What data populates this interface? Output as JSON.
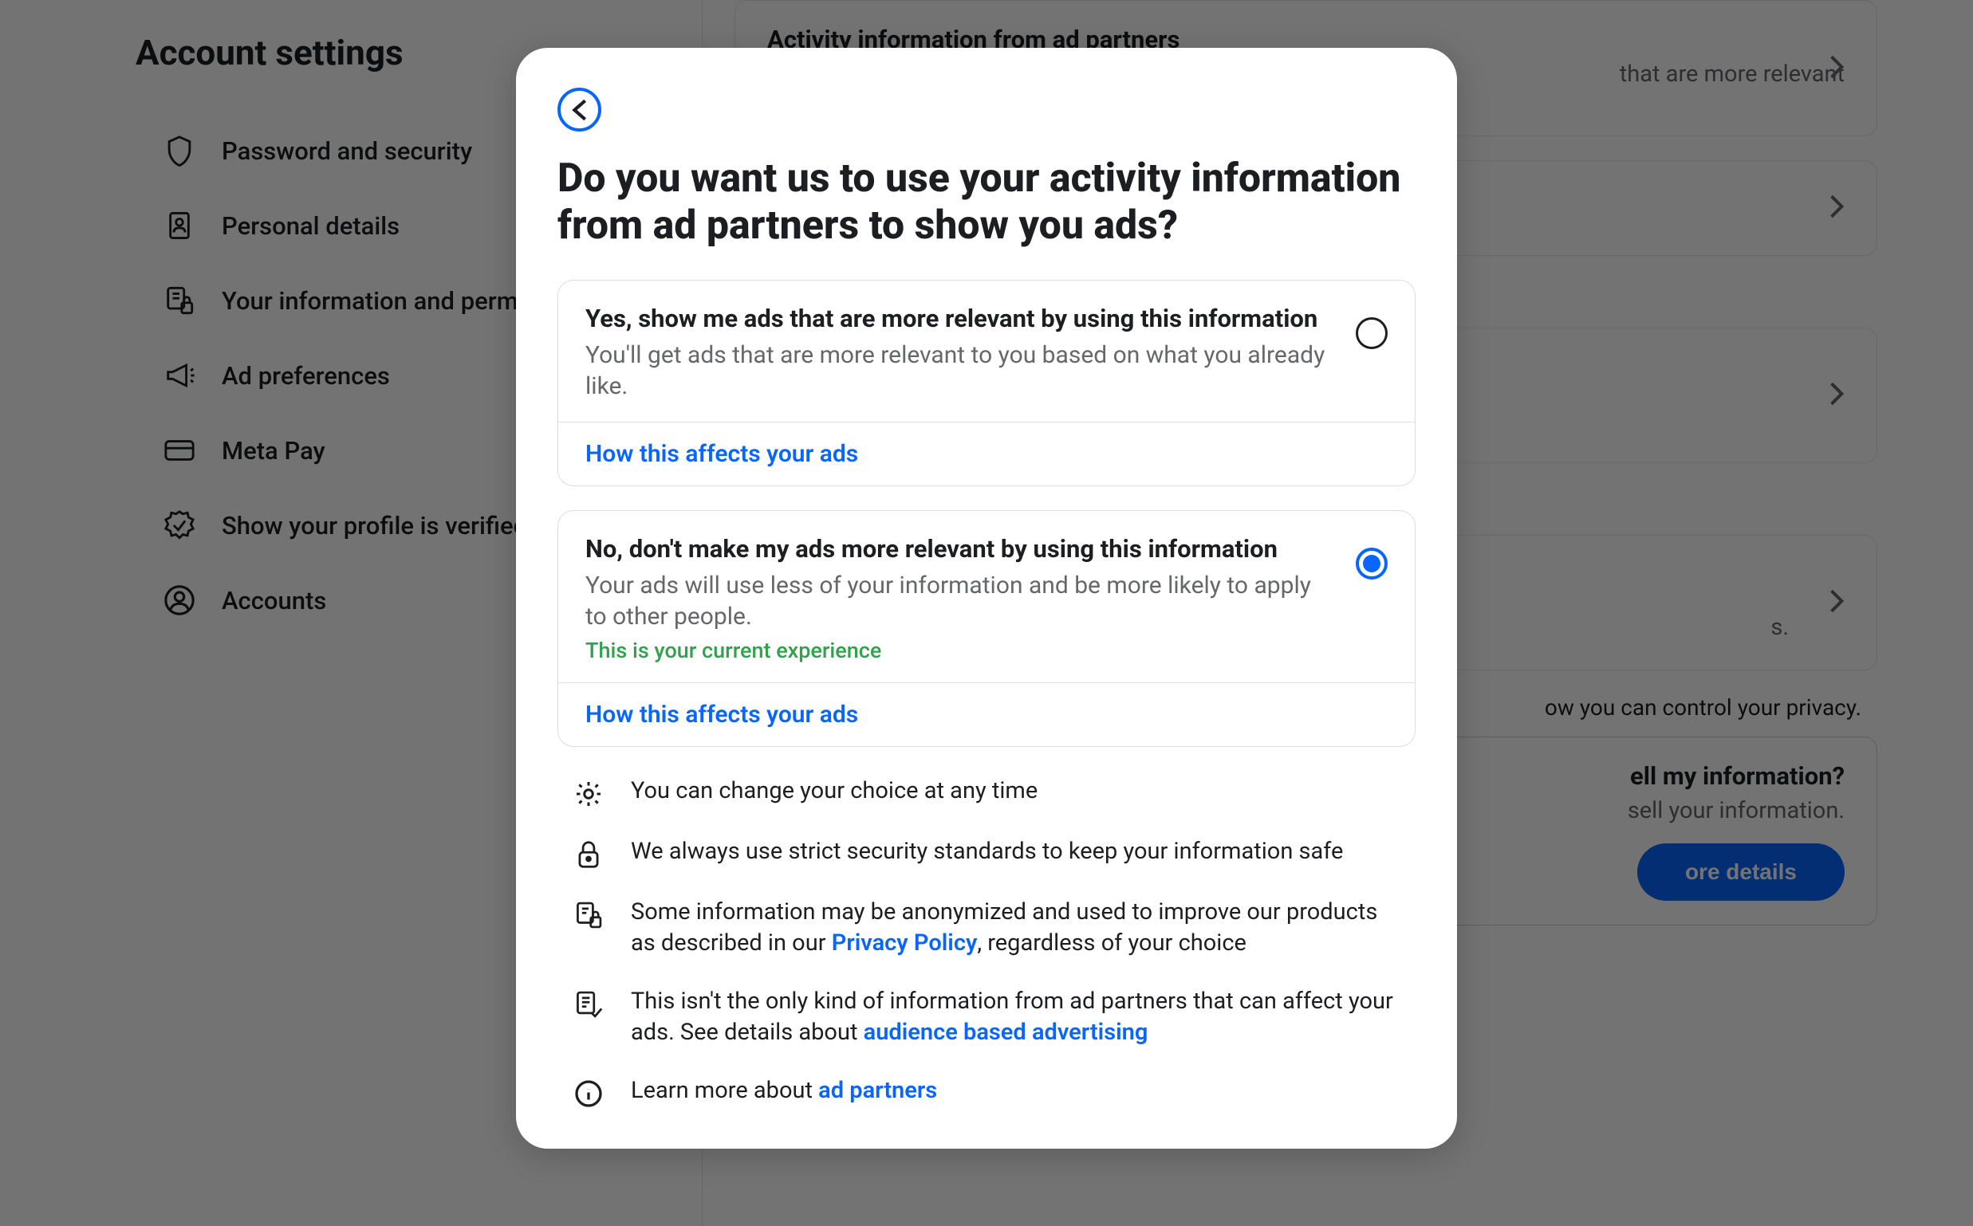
{
  "sidebar": {
    "title": "Account settings",
    "items": [
      {
        "label": "Password and security",
        "icon": "shield-icon"
      },
      {
        "label": "Personal details",
        "icon": "id-card-icon"
      },
      {
        "label": "Your information and permissions",
        "icon": "lock-file-icon"
      },
      {
        "label": "Ad preferences",
        "icon": "megaphone-icon"
      },
      {
        "label": "Meta Pay",
        "icon": "card-icon"
      },
      {
        "label": "Show your profile is verified",
        "icon": "check-badge-icon"
      },
      {
        "label": "Accounts",
        "icon": "person-circle-icon"
      }
    ]
  },
  "bg": {
    "card1_title": "Activity information from ad partners",
    "card1_text_frag": "that are more relevant",
    "card_sell_title": "ell my information?",
    "card_sell_text": "sell your information.",
    "privacy_text_frag": "ow you can control your privacy.",
    "more_details": "ore details",
    "text_frag3": "s."
  },
  "modal": {
    "title": "Do you want us to use your activity information from ad partners to show you ads?",
    "opt_yes_title": "Yes, show me ads that are more relevant by using this information",
    "opt_yes_desc": "You'll get ads that are more relevant to you based on what you already like.",
    "opt_no_title": "No, don't make my ads more relevant by using this information",
    "opt_no_desc": "Your ads will use less of your information and be more likely to apply to other people.",
    "current_label": "This is your current experience",
    "affects_link": "How this affects your ads",
    "info1": "You can change your choice at any time",
    "info2": "We always use strict security standards to keep your information safe",
    "info3_a": "Some information may be anonymized and used to improve our products as described in our ",
    "info3_link": "Privacy Policy",
    "info3_b": ", regardless of your choice",
    "info4_a": "This isn't the only kind of information from ad partners that can affect your ads. See details about ",
    "info4_link": "audience based advertising",
    "info5_a": "Learn more about ",
    "info5_link": "ad partners"
  }
}
